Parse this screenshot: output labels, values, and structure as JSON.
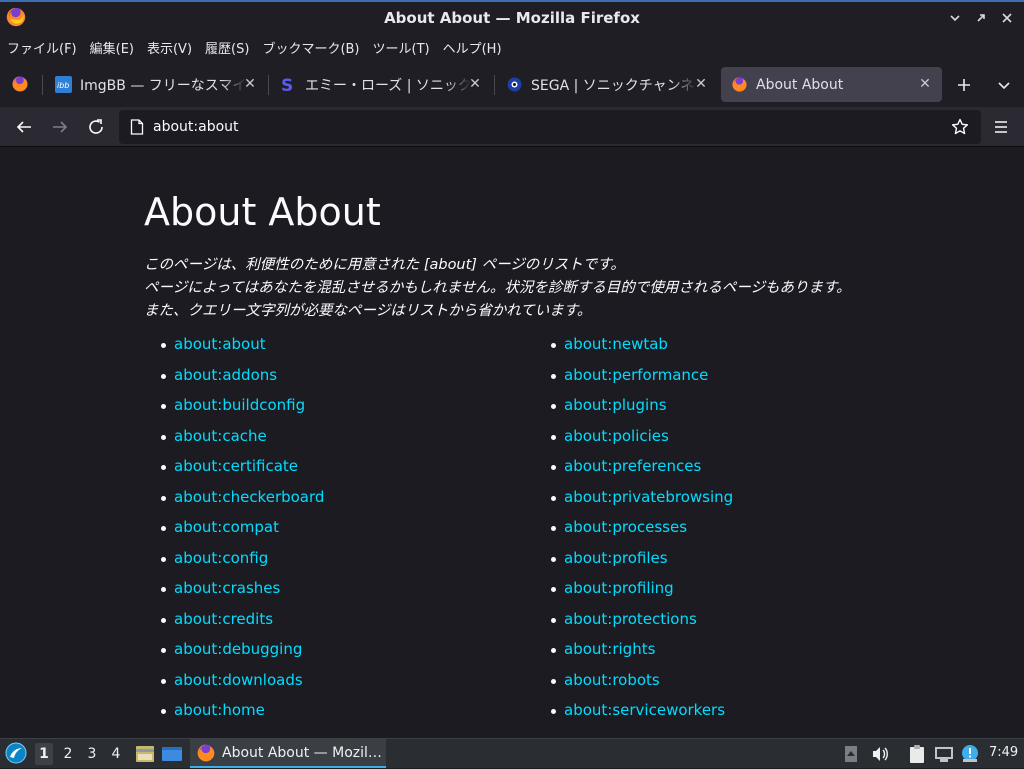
{
  "window": {
    "title": "About About — Mozilla Firefox"
  },
  "menubar": {
    "items": [
      "ファイル(F)",
      "編集(E)",
      "表示(V)",
      "履歴(S)",
      "ブックマーク(B)",
      "ツール(T)",
      "ヘルプ(H)"
    ]
  },
  "tabs": [
    {
      "title": "ImgBB — フリーなスマイリー",
      "icon": "imgbb-icon",
      "active": false
    },
    {
      "title": "エミー・ローズ | ソニックウ",
      "icon": "sonic-s-icon",
      "active": false
    },
    {
      "title": "SEGA | ソニックチャンネル |",
      "icon": "sega-icon",
      "active": false
    },
    {
      "title": "About About",
      "icon": "firefox-icon",
      "active": true
    }
  ],
  "urlbar": {
    "url": "about:about"
  },
  "page": {
    "title": "About About",
    "intro": [
      "このページは、利便性のために用意された [about] ページのリストです。",
      "ページによってはあなたを混乱させるかもしれません。状況を診断する目的で使用されるページもあります。",
      "また、クエリー文字列が必要なページはリストから省かれています。"
    ],
    "links_left": [
      "about:about",
      "about:addons",
      "about:buildconfig",
      "about:cache",
      "about:certificate",
      "about:checkerboard",
      "about:compat",
      "about:config",
      "about:crashes",
      "about:credits",
      "about:debugging",
      "about:downloads",
      "about:home"
    ],
    "links_right": [
      "about:newtab",
      "about:performance",
      "about:plugins",
      "about:policies",
      "about:preferences",
      "about:privatebrowsing",
      "about:processes",
      "about:profiles",
      "about:profiling",
      "about:protections",
      "about:rights",
      "about:robots",
      "about:serviceworkers"
    ]
  },
  "taskbar": {
    "desktops": [
      "1",
      "2",
      "3",
      "4"
    ],
    "active_task": "About About — Mozil…",
    "clock": "7:49"
  },
  "colors": {
    "link": "#00ddff",
    "background": "#1c1b22",
    "accent": "#3daee9"
  }
}
